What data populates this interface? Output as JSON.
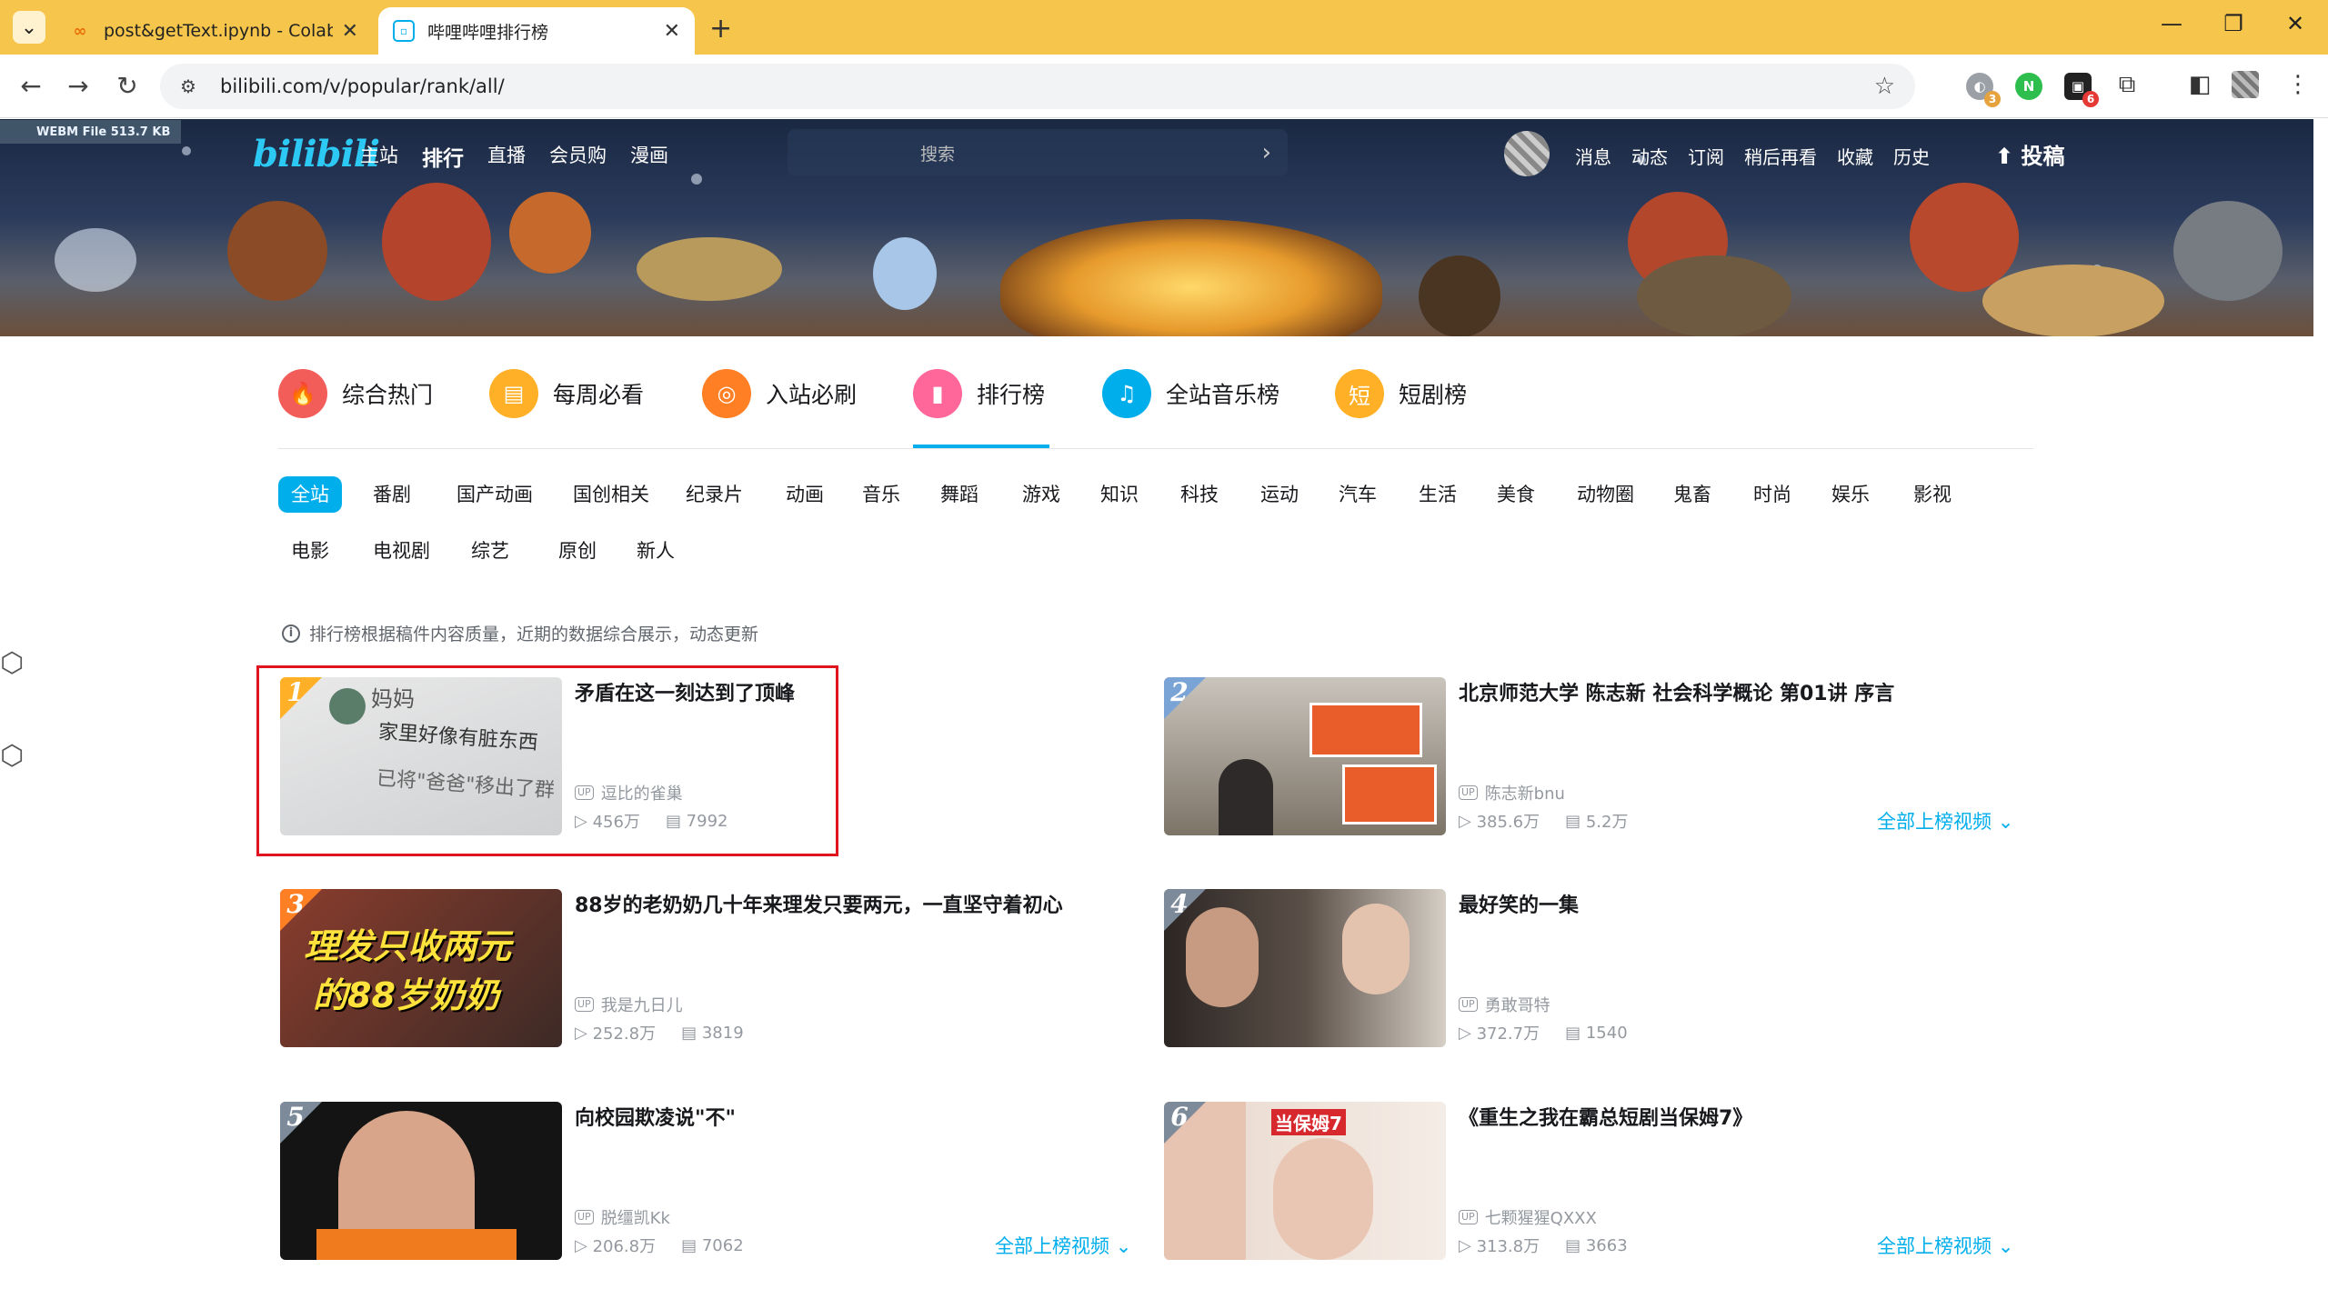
{
  "browser": {
    "tabs": [
      {
        "title": "post&getText.ipynb - Colaborat",
        "close": "✕"
      },
      {
        "title": "哔哩哔哩排行榜",
        "close": "✕"
      }
    ],
    "new_tab": "+",
    "url": "bilibili.com/v/popular/rank/all/",
    "window_controls": [
      "—",
      "❐",
      "✕"
    ],
    "extension_badges": [
      "3",
      "6"
    ]
  },
  "banner": {
    "webm_label": "WEBM File 513.7 KB",
    "logo": "bilibili",
    "nav": [
      "主站",
      "排行",
      "直播",
      "会员购",
      "漫画"
    ],
    "search_placeholder": "搜索",
    "right_nav": [
      "消息",
      "动态",
      "订阅",
      "稍后再看",
      "收藏",
      "历史"
    ],
    "upload": "投稿"
  },
  "channels": [
    {
      "label": "综合热门",
      "icon": "fire-icon",
      "color": "#f25d59"
    },
    {
      "label": "每周必看",
      "icon": "calendar-icon",
      "color": "#ffb027"
    },
    {
      "label": "入站必刷",
      "icon": "medal-icon",
      "color": "#ff7f24"
    },
    {
      "label": "排行榜",
      "icon": "chart-icon",
      "color": "#ff6699"
    },
    {
      "label": "全站音乐榜",
      "icon": "headphone-icon",
      "color": "#00aeec"
    },
    {
      "label": "短剧榜",
      "icon": "short-icon",
      "color": "#ffb027"
    }
  ],
  "categories_row1": [
    "全站",
    "番剧",
    "国产动画",
    "国创相关",
    "纪录片",
    "动画",
    "音乐",
    "舞蹈",
    "游戏",
    "知识",
    "科技",
    "运动",
    "汽车",
    "生活",
    "美食",
    "动物圈",
    "鬼畜",
    "时尚",
    "娱乐",
    "影视"
  ],
  "categories_row2": [
    "电影",
    "电视剧",
    "综艺",
    "原创",
    "新人"
  ],
  "tip": "排行榜根据稿件内容质量，近期的数据综合展示，动态更新",
  "items": [
    {
      "rank": "1",
      "title": "矛盾在这一刻达到了顶峰",
      "up": "逗比的雀巢",
      "views": "456万",
      "danmaku": "7992",
      "thumb_text": [
        "妈妈",
        "家里好像有脏东西",
        "已将\"爸爸\"移出了群"
      ]
    },
    {
      "rank": "2",
      "title": "北京师范大学 陈志新 社会科学概论 第01讲 序言",
      "up": "陈志新bnu",
      "views": "385.6万",
      "danmaku": "5.2万"
    },
    {
      "rank": "3",
      "title": "88岁的老奶奶几十年来理发只要两元，一直坚守着初心",
      "up": "我是九日儿",
      "views": "252.8万",
      "danmaku": "3819",
      "thumb_text": [
        "理发只收两元",
        "的88岁奶奶"
      ]
    },
    {
      "rank": "4",
      "title": "最好笑的一集",
      "up": "勇敢哥特",
      "views": "372.7万",
      "danmaku": "1540"
    },
    {
      "rank": "5",
      "title": "向校园欺凌说\"不\"",
      "up": "脱缰凯Kk",
      "views": "206.8万",
      "danmaku": "7062"
    },
    {
      "rank": "6",
      "title": "《重生之我在霸总短剧当保姆7》",
      "up": "七颗猩猩QXXX",
      "views": "313.8万",
      "danmaku": "3663",
      "thumb_text": [
        "当保姆7"
      ]
    }
  ],
  "more_label": "全部上榜视频",
  "up_tag": "UP"
}
